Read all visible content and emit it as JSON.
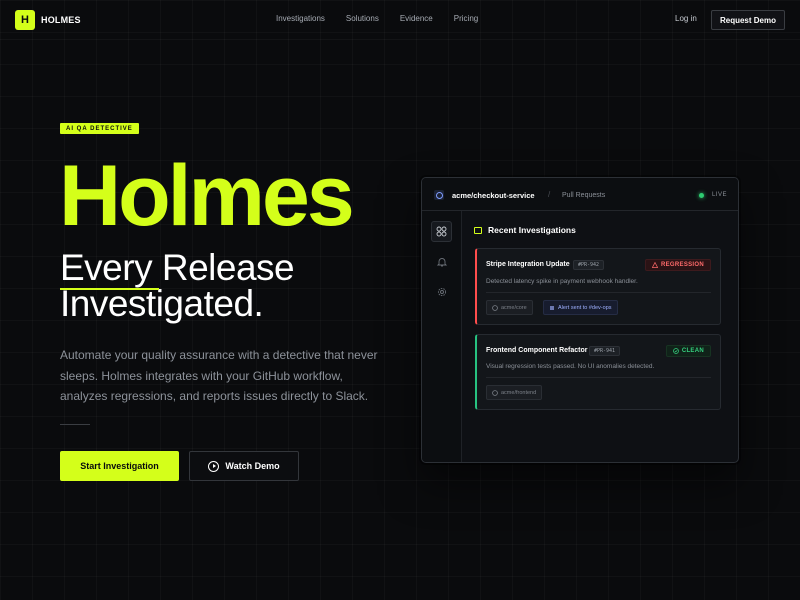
{
  "nav": {
    "logo_letter": "H",
    "brand": "HOLMES",
    "links": [
      "Investigations",
      "Solutions",
      "Evidence",
      "Pricing"
    ],
    "login": "Log in",
    "cta": "Request Demo"
  },
  "hero": {
    "badge": "AI QA DETECTIVE",
    "title": "Holmes",
    "subtitle_line1": "Every Release",
    "subtitle_line2": "Investigated.",
    "description": "Automate your quality assurance with a detective that never sleeps. Holmes integrates with your GitHub workflow, analyzes regressions, and reports issues directly to Slack.",
    "primary_button": "Start Investigation",
    "secondary_button": "Watch Demo"
  },
  "window": {
    "repo": "acme/checkout-service",
    "separator": "/",
    "page": "Pull Requests",
    "live_label": "LIVE",
    "section_title": "Recent Investigations",
    "cards": [
      {
        "title": "Stripe Integration Update",
        "pr": "#PR-942",
        "status": "REGRESSION",
        "description": "Detected latency spike in payment webhook handler.",
        "repo_chip": "acme/core",
        "slack_chip": "Alert sent to #dev-ops"
      },
      {
        "title": "Frontend Component Refactor",
        "pr": "#PR-941",
        "status": "CLEAN",
        "description": "Visual regression tests passed. No UI anomalies detected.",
        "repo_chip": "acme/frontend"
      }
    ]
  },
  "colors": {
    "accent": "#d4ff1a",
    "background": "#0a0b0d",
    "regression": "#ff4d4d",
    "clean": "#27c281"
  },
  "icons": [
    "github-icon",
    "grid-icon",
    "bell-icon",
    "gear-icon",
    "play-icon",
    "warning-icon",
    "check-icon",
    "slack-icon"
  ]
}
